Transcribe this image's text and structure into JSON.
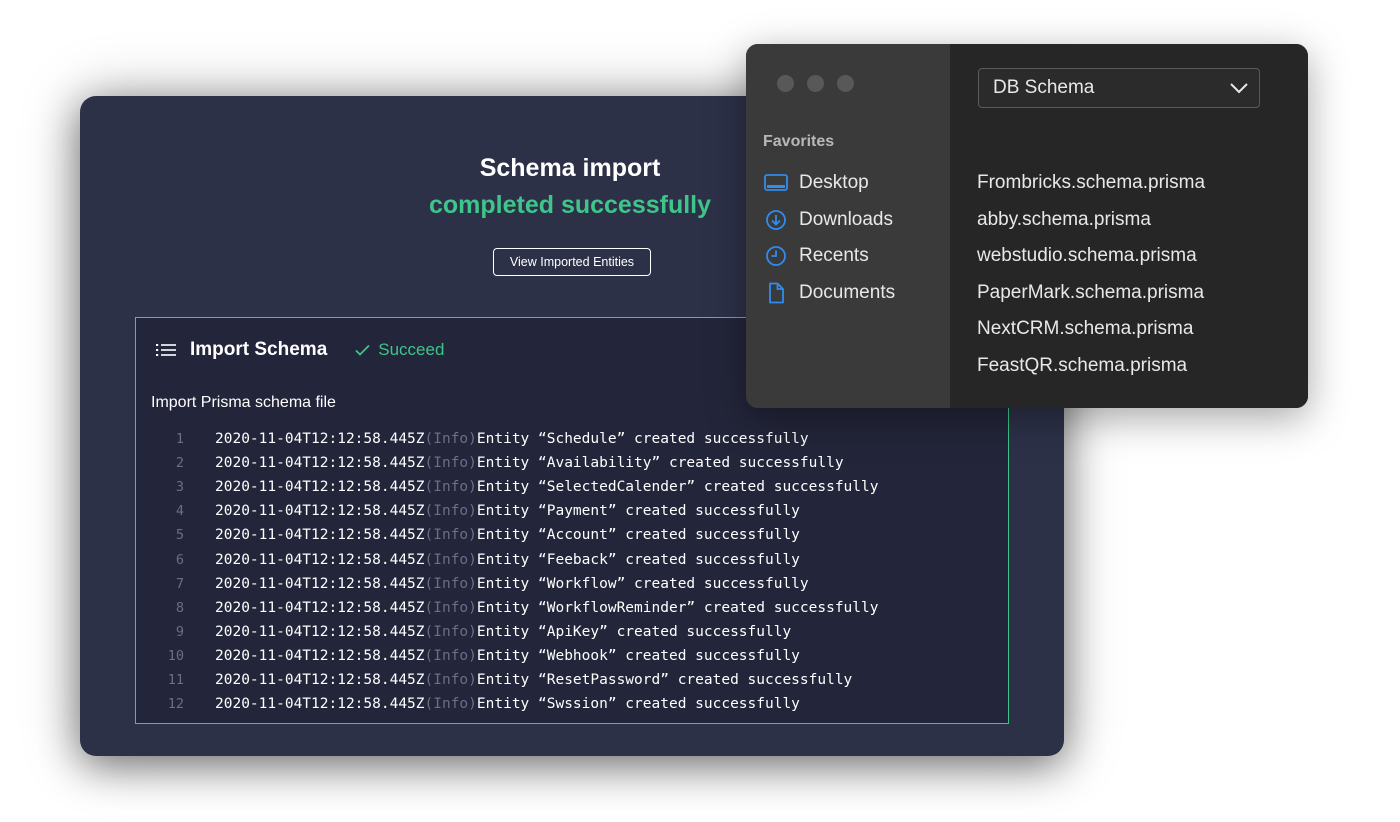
{
  "main": {
    "title": "Schema import",
    "subtitle": "completed successfully",
    "view_button": "View Imported Entities",
    "accent_color": "#3ec58a",
    "log": {
      "title": "Import Schema",
      "status": "Succeed",
      "caption": "Import Prisma schema file",
      "lines": [
        {
          "n": "1",
          "ts": "2020-11-04T12:12:58.445Z",
          "level": "(Info)",
          "msg": "Entity “Schedule” created successfully"
        },
        {
          "n": "2",
          "ts": "2020-11-04T12:12:58.445Z",
          "level": "(Info)",
          "msg": "Entity “Availability” created successfully"
        },
        {
          "n": "3",
          "ts": "2020-11-04T12:12:58.445Z",
          "level": "(Info)",
          "msg": "Entity “SelectedCalender” created successfully"
        },
        {
          "n": "4",
          "ts": "2020-11-04T12:12:58.445Z",
          "level": "(Info)",
          "msg": "Entity “Payment” created successfully"
        },
        {
          "n": "5",
          "ts": "2020-11-04T12:12:58.445Z",
          "level": "(Info)",
          "msg": "Entity “Account” created successfully"
        },
        {
          "n": "6",
          "ts": "2020-11-04T12:12:58.445Z",
          "level": "(Info)",
          "msg": "Entity “Feeback” created successfully"
        },
        {
          "n": "7",
          "ts": "2020-11-04T12:12:58.445Z",
          "level": "(Info)",
          "msg": "Entity “Workflow” created successfully"
        },
        {
          "n": "8",
          "ts": "2020-11-04T12:12:58.445Z",
          "level": "(Info)",
          "msg": "Entity “WorkflowReminder” created successfully"
        },
        {
          "n": "9",
          "ts": "2020-11-04T12:12:58.445Z",
          "level": "(Info)",
          "msg": "Entity “ApiKey” created successfully"
        },
        {
          "n": "10",
          "ts": "2020-11-04T12:12:58.445Z",
          "level": "(Info)",
          "msg": "Entity “Webhook” created successfully"
        },
        {
          "n": "11",
          "ts": "2020-11-04T12:12:58.445Z",
          "level": "(Info)",
          "msg": "Entity “ResetPassword” created successfully"
        },
        {
          "n": "12",
          "ts": "2020-11-04T12:12:58.445Z",
          "level": "(Info)",
          "msg": "Entity “Swssion” created successfully"
        }
      ]
    }
  },
  "picker": {
    "favorites_title": "Favorites",
    "sidebar": [
      {
        "label": "Desktop",
        "icon": "desktop-icon"
      },
      {
        "label": "Downloads",
        "icon": "download-icon"
      },
      {
        "label": "Recents",
        "icon": "clock-icon"
      },
      {
        "label": "Documents",
        "icon": "document-icon"
      }
    ],
    "select_value": "DB Schema",
    "files": [
      "Frombricks.schema.prisma",
      "abby.schema.prisma",
      "webstudio.schema.prisma",
      "PaperMark.schema.prisma",
      "NextCRM.schema.prisma",
      "FeastQR.schema.prisma"
    ],
    "icon_color": "#2f8cf0"
  }
}
